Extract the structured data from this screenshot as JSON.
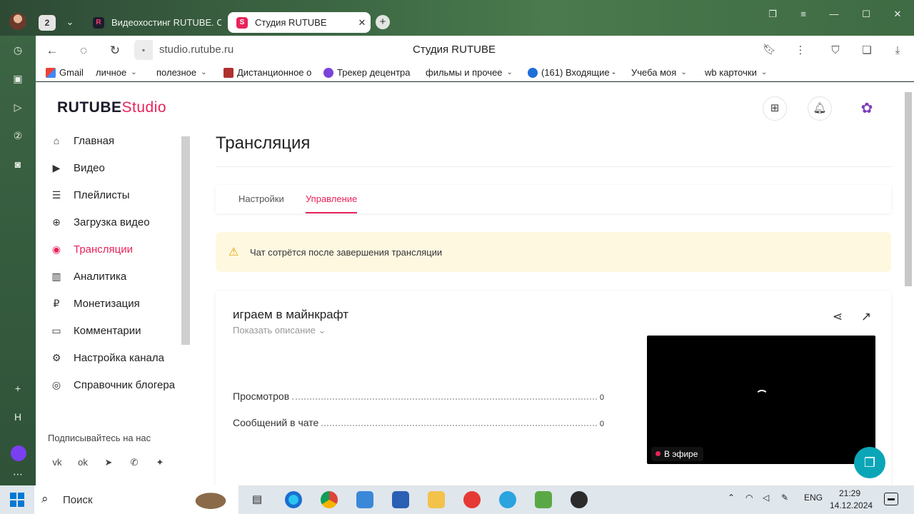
{
  "browser": {
    "tab_count": "2",
    "tabs": [
      {
        "label": "Видеохостинг RUTUBE. С",
        "favicon": "R"
      },
      {
        "label": "Студия RUTUBE",
        "favicon": "S"
      }
    ],
    "url": "studio.rutube.ru",
    "page_title": "Студия RUTUBE",
    "bookmarks": [
      {
        "label": "Gmail",
        "icon": "gmail-icon",
        "dropdown": false
      },
      {
        "label": "личное",
        "icon": "",
        "dropdown": true
      },
      {
        "label": "полезное",
        "icon": "",
        "dropdown": true
      },
      {
        "label": "Дистанционное о",
        "icon": "site-icon",
        "dropdown": false
      },
      {
        "label": "Трекер децентра",
        "icon": "site-icon",
        "dropdown": false
      },
      {
        "label": "фильмы и прочее",
        "icon": "",
        "dropdown": true
      },
      {
        "label": "(161) Входящие -",
        "icon": "mail-icon",
        "dropdown": false
      },
      {
        "label": "Учеба моя",
        "icon": "",
        "dropdown": true
      },
      {
        "label": "wb карточки",
        "icon": "",
        "dropdown": true
      }
    ]
  },
  "app": {
    "logo_main": "RUTUBE",
    "logo_accent": "Studio",
    "accent_color": "#e8235a"
  },
  "sidebar": {
    "items": [
      {
        "label": "Главная",
        "icon": "home-icon",
        "glyph": "⌂",
        "active": false
      },
      {
        "label": "Видео",
        "icon": "video-icon",
        "glyph": "▶",
        "active": false
      },
      {
        "label": "Плейлисты",
        "icon": "playlist-icon",
        "glyph": "☰",
        "active": false
      },
      {
        "label": "Загрузка видео",
        "icon": "upload-icon",
        "glyph": "⊕",
        "active": false
      },
      {
        "label": "Трансляции",
        "icon": "broadcast-icon",
        "glyph": "◉",
        "active": true
      },
      {
        "label": "Аналитика",
        "icon": "analytics-icon",
        "glyph": "▥",
        "active": false
      },
      {
        "label": "Монетизация",
        "icon": "ruble-icon",
        "glyph": "₽",
        "active": false
      },
      {
        "label": "Комментарии",
        "icon": "comment-icon",
        "glyph": "▭",
        "active": false
      },
      {
        "label": "Настройка канала",
        "icon": "gear-icon",
        "glyph": "⚙",
        "active": false
      },
      {
        "label": "Справочник блогера",
        "icon": "guide-icon",
        "glyph": "◎",
        "active": false
      }
    ],
    "follow_label": "Подписывайтесь на нас",
    "socials": [
      {
        "icon": "vk-icon",
        "glyph": "vk"
      },
      {
        "icon": "ok-icon",
        "glyph": "ok"
      },
      {
        "icon": "telegram-icon",
        "glyph": "➤"
      },
      {
        "icon": "viber-icon",
        "glyph": "✆"
      },
      {
        "icon": "zen-icon",
        "glyph": "✦"
      }
    ]
  },
  "main": {
    "title": "Трансляция",
    "tabs": [
      {
        "label": "Настройки",
        "active": false
      },
      {
        "label": "Управление",
        "active": true
      }
    ],
    "warning": "Чат сотрётся после завершения трансляции",
    "stream": {
      "title": "играем в майнкрафт",
      "show_description": "Показать описание",
      "stats": [
        {
          "label": "Просмотров",
          "value": "0"
        },
        {
          "label": "Сообщений в чате",
          "value": "0"
        }
      ],
      "live_badge": "В эфире"
    }
  },
  "taskbar": {
    "search_placeholder": "Поиск",
    "language": "ENG",
    "time": "21:29",
    "date": "14.12.2024"
  }
}
